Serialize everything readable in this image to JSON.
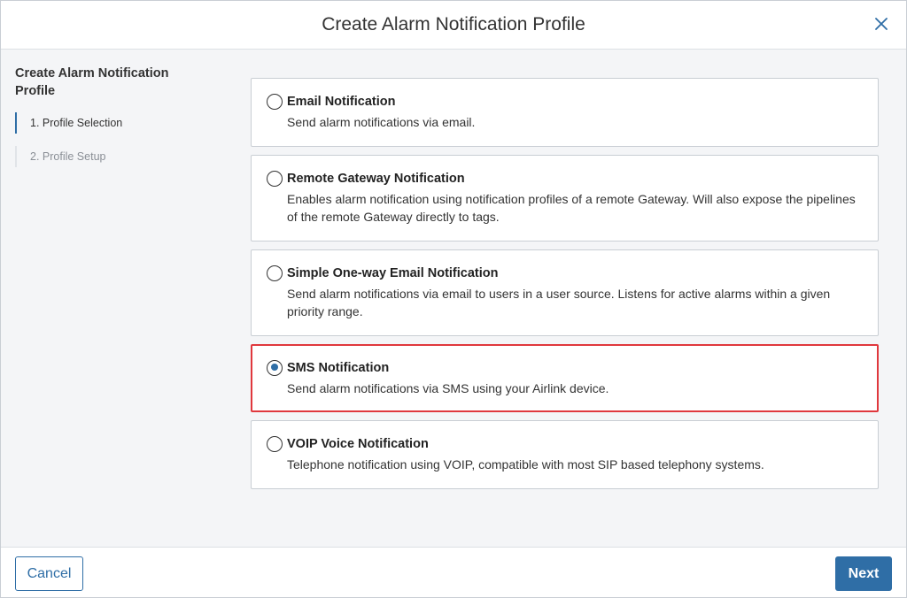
{
  "header": {
    "title": "Create Alarm Notification Profile",
    "close_icon": "close-icon"
  },
  "sidebar": {
    "title": "Create Alarm Notification Profile",
    "steps": [
      {
        "label": "1. Profile Selection",
        "active": true
      },
      {
        "label": "2. Profile Setup",
        "active": false
      }
    ]
  },
  "options": [
    {
      "title": "Email Notification",
      "description": "Send alarm notifications via email.",
      "selected": false
    },
    {
      "title": "Remote Gateway Notification",
      "description": "Enables alarm notification using notification profiles of a remote Gateway. Will also expose the pipelines of the remote Gateway directly to tags.",
      "selected": false
    },
    {
      "title": "Simple One-way Email Notification",
      "description": "Send alarm notifications via email to users in a user source. Listens for active alarms within a given priority range.",
      "selected": false
    },
    {
      "title": "SMS Notification",
      "description": "Send alarm notifications via SMS using your Airlink device.",
      "selected": true
    },
    {
      "title": "VOIP Voice Notification",
      "description": "Telephone notification using VOIP, compatible with most SIP based telephony systems.",
      "selected": false
    }
  ],
  "footer": {
    "cancel_label": "Cancel",
    "next_label": "Next"
  },
  "colors": {
    "accent": "#2f6ea6",
    "highlight": "#e0383d"
  }
}
